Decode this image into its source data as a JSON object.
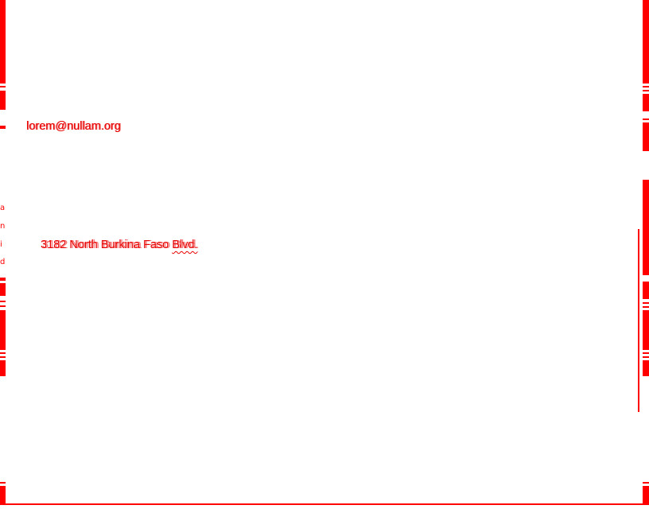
{
  "form": {
    "email_value": "lorem@nullam.org",
    "address_value": "3182 North Burkina Faso Blvd.",
    "address_misspelled_word": "Blvd."
  },
  "colors": {
    "accent": "#ff0000",
    "text": "#e80000",
    "background": "#ffffff"
  }
}
